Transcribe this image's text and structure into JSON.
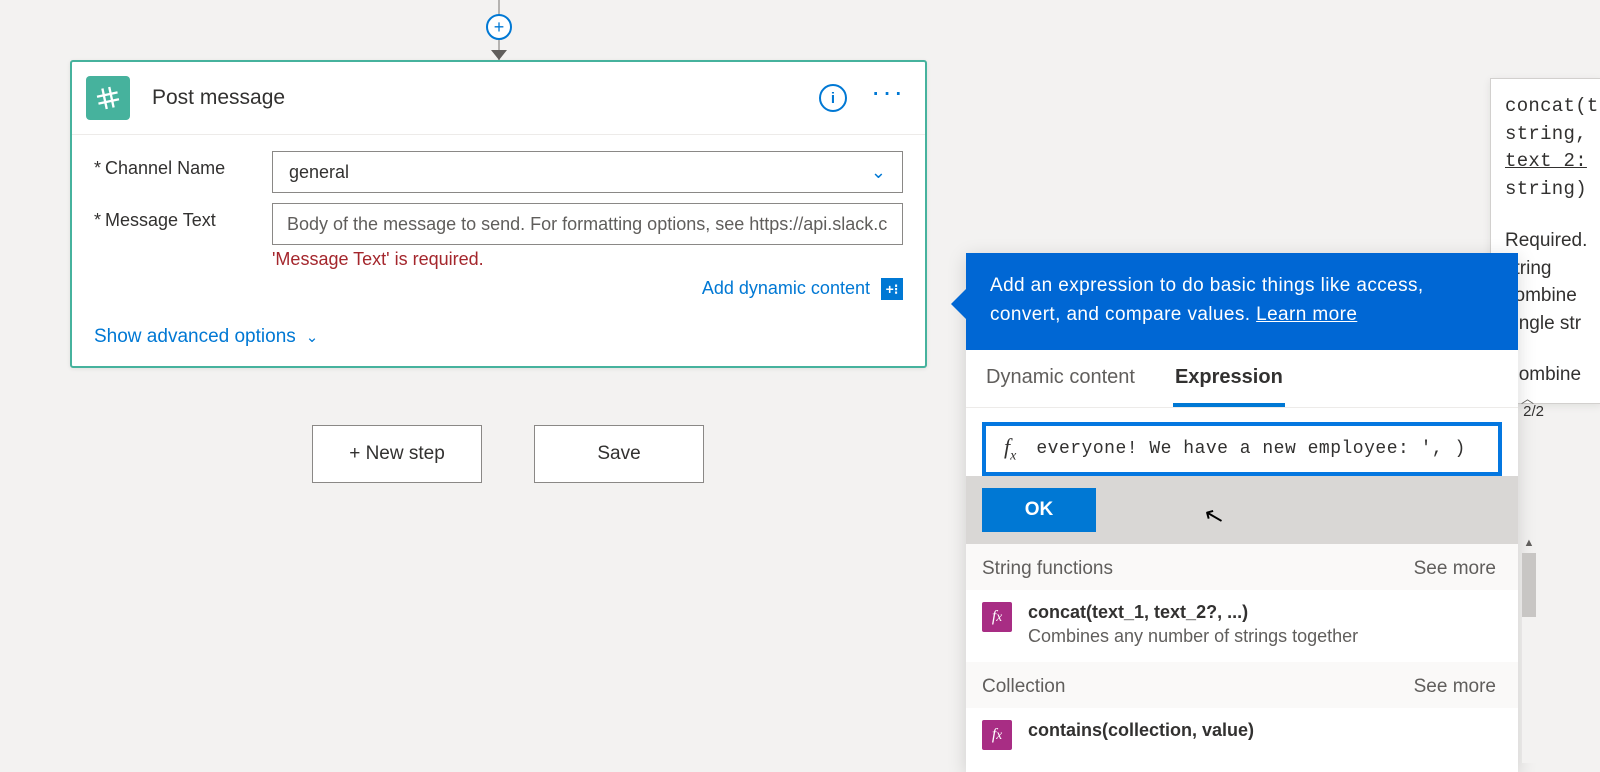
{
  "action_card": {
    "title": "Post message",
    "fields": {
      "channel": {
        "label": "Channel Name",
        "value": "general"
      },
      "message": {
        "label": "Message Text",
        "placeholder": "Body of the message to send. For formatting options, see https://api.slack.com",
        "error": "'Message Text' is required."
      }
    },
    "add_dynamic_label": "Add dynamic content",
    "show_advanced_label": "Show advanced options"
  },
  "buttons": {
    "new_step": "+ New step",
    "save": "Save"
  },
  "popup": {
    "hint_line1": "Add an expression to do basic things like access,",
    "hint_line2": "convert, and compare values. ",
    "learn_more": "Learn more",
    "tabs": {
      "dynamic": "Dynamic content",
      "expression": "Expression"
    },
    "pager": "2/2",
    "expression_value": "everyone! We have a new employee: ', )",
    "ok": "OK",
    "categories": {
      "string": {
        "label": "String functions",
        "see_more": "See more"
      },
      "collection": {
        "label": "Collection",
        "see_more": "See more"
      }
    },
    "functions": {
      "concat": {
        "signature": "concat(text_1, text_2?, ...)",
        "description": "Combines any number of strings together"
      },
      "contains": {
        "signature": "contains(collection, value)"
      }
    }
  },
  "tooltip": {
    "l1": "concat(t",
    "l2": "string,",
    "l3": "text_2:",
    "l4": "string)",
    "r1": "Required.",
    "r2": "string",
    "r3": "combine",
    "r4": "single str",
    "r5": "Combine"
  }
}
